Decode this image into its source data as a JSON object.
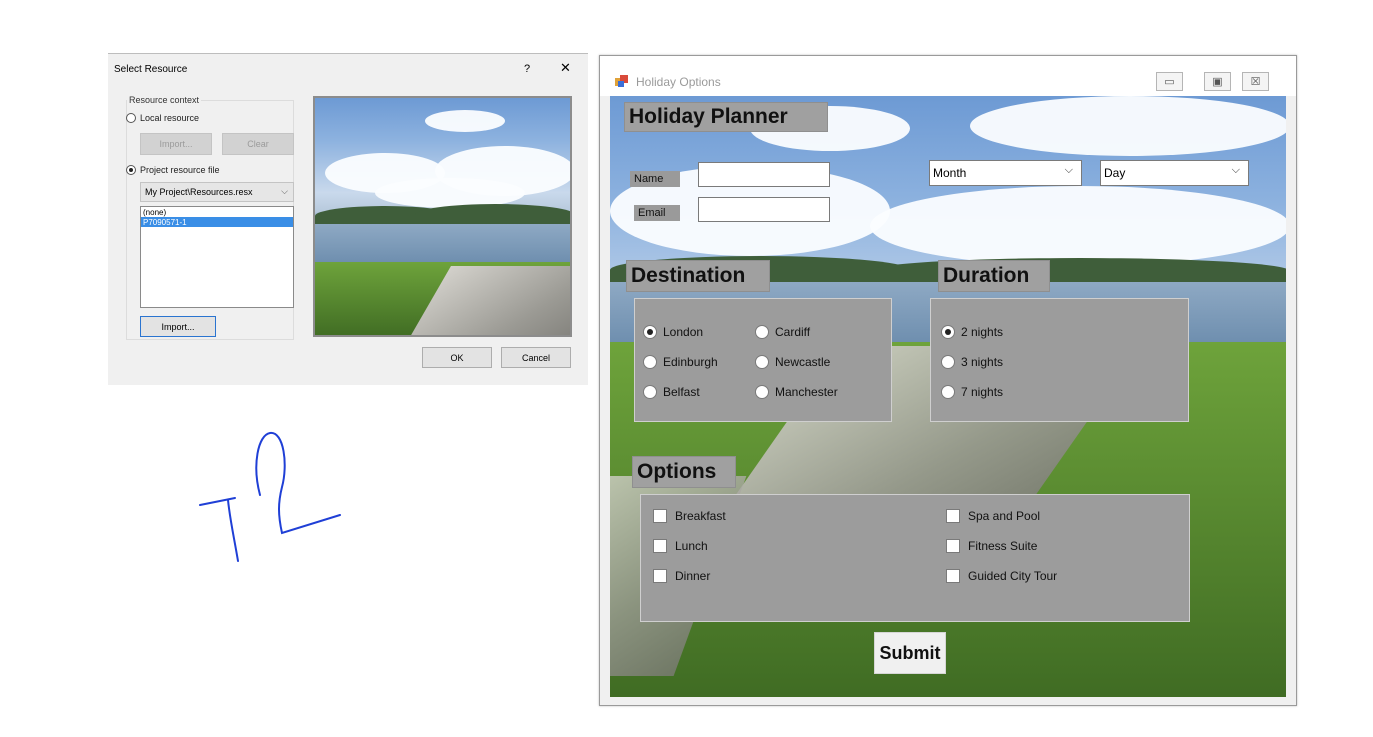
{
  "dialog": {
    "title": "Select Resource",
    "help_label": "?",
    "close_label": "✕",
    "group_label": "Resource context",
    "local_resource_label": "Local resource",
    "import_label": "Import...",
    "clear_label": "Clear",
    "project_resource_label": "Project resource file",
    "resource_file": "My Project\\Resources.resx",
    "list_items": [
      "(none)",
      "P7090571-1"
    ],
    "list_selected": "P7090571-1",
    "import_button_label": "Import...",
    "ok_label": "OK",
    "cancel_label": "Cancel"
  },
  "window": {
    "title": "Holiday Options",
    "minimize_label": "▭",
    "maximize_label": "▣",
    "close_label": "☒"
  },
  "form": {
    "heading": "Holiday Planner",
    "name_label": "Name",
    "email_label": "Email",
    "name_value": "",
    "email_value": "",
    "month_value": "Month",
    "day_value": "Day",
    "destination_heading": "Destination",
    "destinations": [
      "London",
      "Cardiff",
      "Edinburgh",
      "Newcastle",
      "Belfast",
      "Manchester"
    ],
    "destination_selected": "London",
    "duration_heading": "Duration",
    "durations": [
      "2 nights",
      "3 nights",
      "7 nights"
    ],
    "duration_selected": "2 nights",
    "options_heading": "Options",
    "options": [
      "Breakfast",
      "Lunch",
      "Dinner",
      "Spa and Pool",
      "Fitness Suite",
      "Guided City Tour"
    ],
    "submit_label": "Submit"
  },
  "annotation": {
    "handwriting_color": "#1f3fd6"
  },
  "colors": {
    "panel_gray": "#9c9c9c",
    "selection_blue": "#3a8ee6"
  }
}
